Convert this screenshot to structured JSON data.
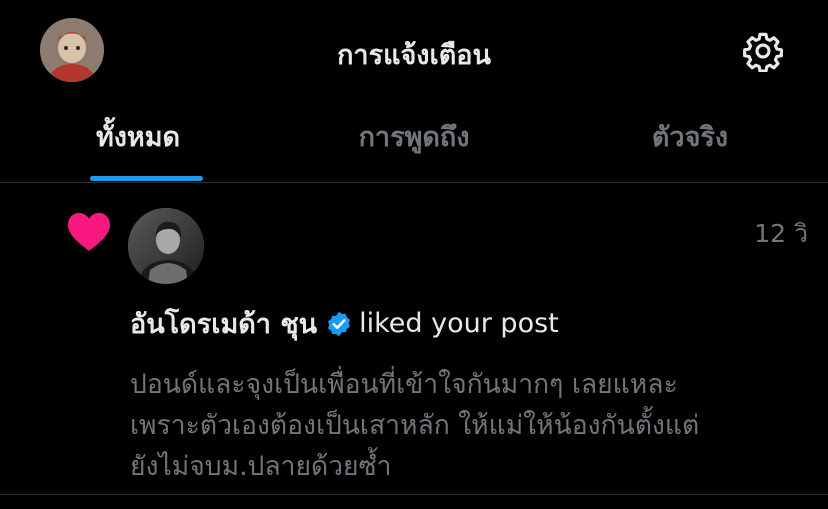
{
  "header": {
    "title": "การแจ้งเตือน",
    "avatar_icon": "user-avatar-icon",
    "settings_icon": "gear-icon"
  },
  "tabs": [
    {
      "label": "ทั้งหมด",
      "active": true
    },
    {
      "label": "การพูดถึง",
      "active": false
    },
    {
      "label": "ตัวจริง",
      "active": false
    }
  ],
  "notification": {
    "type_icon": "heart-icon",
    "time": "12 วิ",
    "actor_name": "อันโดรเมด้า ชุน",
    "verified_icon": "verified-badge-icon",
    "action": "liked your post",
    "post_lines": [
      "ปอนด์และจุงเป็นเพื่อนที่เข้าใจกันมากๆ เลยแหละ",
      "เพราะตัวเองต้องเป็นเสาหลัก ให้แม่ให้น้องกันตั้งแต่",
      "ยังไม่จบม.ปลายด้วยซ้ำ"
    ]
  },
  "colors": {
    "background": "#000000",
    "accent": "#1d9bf0",
    "like": "#f91880",
    "muted_text": "#71767b",
    "primary_text": "#e7e9ea",
    "divider": "#2f3336"
  }
}
